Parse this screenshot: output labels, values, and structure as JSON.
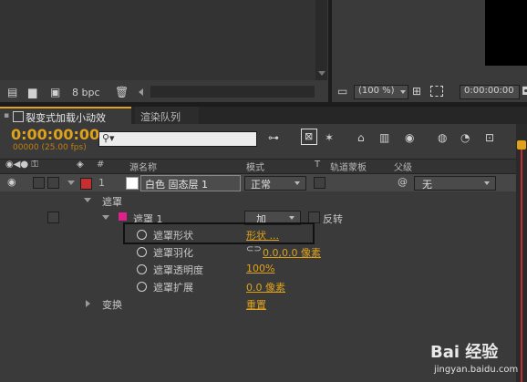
{
  "project_footer": {
    "bpc_label": "8 bpc"
  },
  "viewer_footer": {
    "zoom": "(100 %)",
    "timecode": "0:00:00:00",
    "timecode2": "0:00:00:0"
  },
  "tabs": [
    {
      "label": "裂变式加载小动效",
      "active": true
    },
    {
      "label": "渲染队列",
      "active": false
    }
  ],
  "timeline": {
    "current_time": "0:00:00:00",
    "frame_info": "00000 (25.00 fps)",
    "search_placeholder": ""
  },
  "columns": {
    "num": "#",
    "source_name": "源名称",
    "mode": "模式",
    "t": "T",
    "track_matte": "轨道蒙板",
    "parent": "父级"
  },
  "layer": {
    "index": "1",
    "label_color": "#c4302f",
    "name": "白色 固态层 1",
    "mode": "正常",
    "parent": "无"
  },
  "masks_group": {
    "label": "遮罩"
  },
  "mask1": {
    "name": "遮罩 1",
    "color": "#e0218a",
    "mode": "加",
    "invert_label": "反转"
  },
  "mask_props": [
    {
      "label": "遮罩形状",
      "value": "形状 ..."
    },
    {
      "label": "遮罩羽化",
      "value": "0.0,0.0 像素"
    },
    {
      "label": "遮罩透明度",
      "value": "100%"
    },
    {
      "label": "遮罩扩展",
      "value": "0.0 像素"
    }
  ],
  "transform": {
    "label": "变换",
    "reset": "重置"
  },
  "watermark": {
    "brand": "Bai 经验",
    "url": "jingyan.baidu.com"
  },
  "colors": {
    "accent": "#e0a21a",
    "highlight_box": "#111111"
  }
}
